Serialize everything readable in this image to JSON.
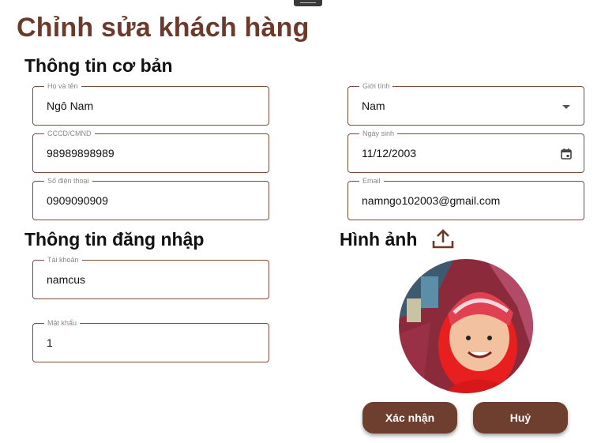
{
  "title": "Chỉnh sửa khách hàng",
  "sections": {
    "basic": "Thông tin cơ bản",
    "login": "Thông tin đăng nhập",
    "image": "Hình ảnh"
  },
  "fields": {
    "name": {
      "label": "Họ và tên",
      "value": "Ngô Nam"
    },
    "gender": {
      "label": "Giới tính",
      "value": "Nam"
    },
    "id_card": {
      "label": "CCCD/CMND",
      "value": "98989898989"
    },
    "birthday": {
      "label": "Ngày sinh",
      "value": "11/12/2003"
    },
    "phone": {
      "label": "Số điện thoại",
      "value": "0909090909"
    },
    "email": {
      "label": "Email",
      "value": "namngo102003@gmail.com"
    },
    "username": {
      "label": "Tài khoản",
      "value": "namcus"
    },
    "password": {
      "label": "Mật khẩu",
      "value": "1"
    }
  },
  "buttons": {
    "confirm": "Xác nhận",
    "cancel": "Huỷ"
  },
  "colors": {
    "accent": "#6b3a2a",
    "button": "#6e3f2e",
    "border": "#7a4a3a"
  },
  "icons": {
    "upload": "upload-icon",
    "dropdown": "arrow-drop-down-icon",
    "calendar": "calendar-icon"
  }
}
